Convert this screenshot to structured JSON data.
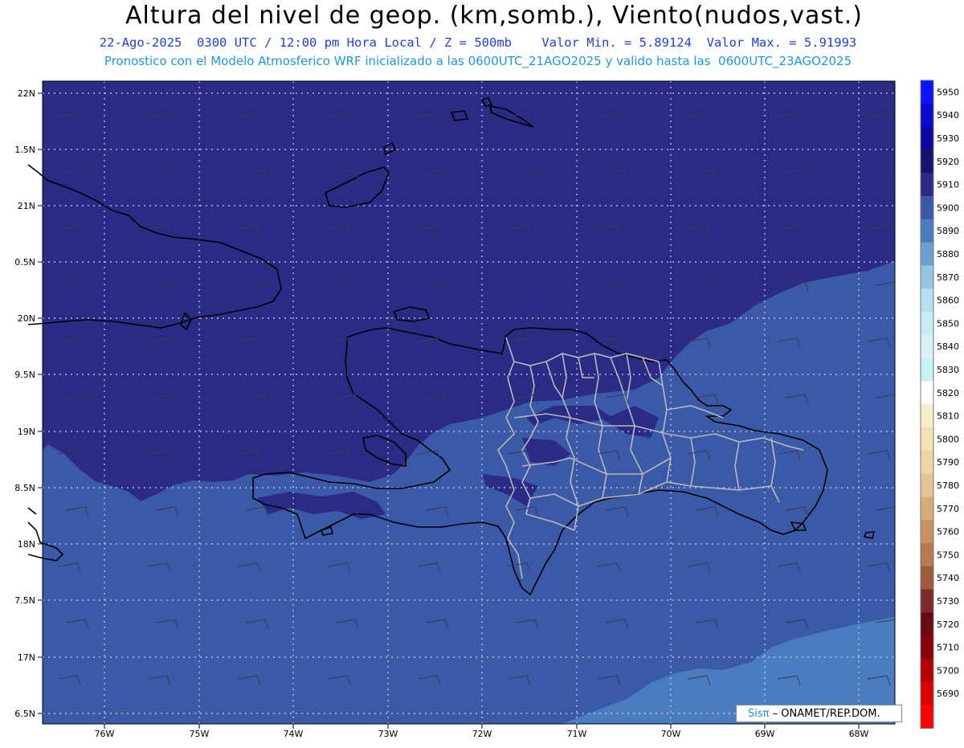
{
  "header": {
    "title": "Altura del nivel de geop. (km,somb.), Viento(nudos,vast.)",
    "subtitle_line1": "22-Ago-2025  0300 UTC / 12:00 pm Hora Local / Z = 500mb    Valor Min. = 5.89124  Valor Max. = 5.91993",
    "subtitle_line2": "Pronostico con el Modelo Atmosferico WRF inicializado a las 0600UTC_21AGO2025 y valido hasta las  0600UTC_23AGO2025"
  },
  "map": {
    "lat_labels": [
      "22N",
      "1.5N",
      "21N",
      "0.5N",
      "20N",
      "9.5N",
      "19N",
      "8.5N",
      "18N",
      "7.5N",
      "17N",
      "6.5N"
    ],
    "lon_labels": [
      "76W",
      "75W",
      "74W",
      "73W",
      "72W",
      "71W",
      "70W",
      "69W",
      "68W"
    ],
    "colors": {
      "level_5910": "#2b2b86",
      "level_5900": "#3a5aa8",
      "level_5890": "#4a7dbf",
      "coast": "#000000",
      "province_borders": "#b8b8b8"
    }
  },
  "colorbar": {
    "levels": [
      "5950",
      "5940",
      "5930",
      "5920",
      "5910",
      "5900",
      "5890",
      "5880",
      "5870",
      "5860",
      "5850",
      "5840",
      "5830",
      "5820",
      "5810",
      "5800",
      "5790",
      "5780",
      "5770",
      "5760",
      "5750",
      "5740",
      "5730",
      "5720",
      "5710",
      "5700",
      "5690"
    ],
    "colors": [
      "#0a14ff",
      "#0a0ad2",
      "#0a0aa0",
      "#14146e",
      "#2b2b86",
      "#3a5aa8",
      "#4a7dbf",
      "#6ea0cf",
      "#93c5e0",
      "#b2e0ee",
      "#c8ecf4",
      "#d8f2f8",
      "#c6f2f6",
      "#ffffff",
      "#f7eccb",
      "#f2e2b6",
      "#ecd6a4",
      "#e4c696",
      "#d8ae76",
      "#c99060",
      "#b87a4e",
      "#9e5a3c",
      "#7e2a2a",
      "#6a0a14",
      "#8a0008",
      "#b40000",
      "#dc0000",
      "#ff0000"
    ]
  },
  "credit": {
    "sis": "Sisπ",
    "org": "– ONAMET/REP.DOM."
  }
}
